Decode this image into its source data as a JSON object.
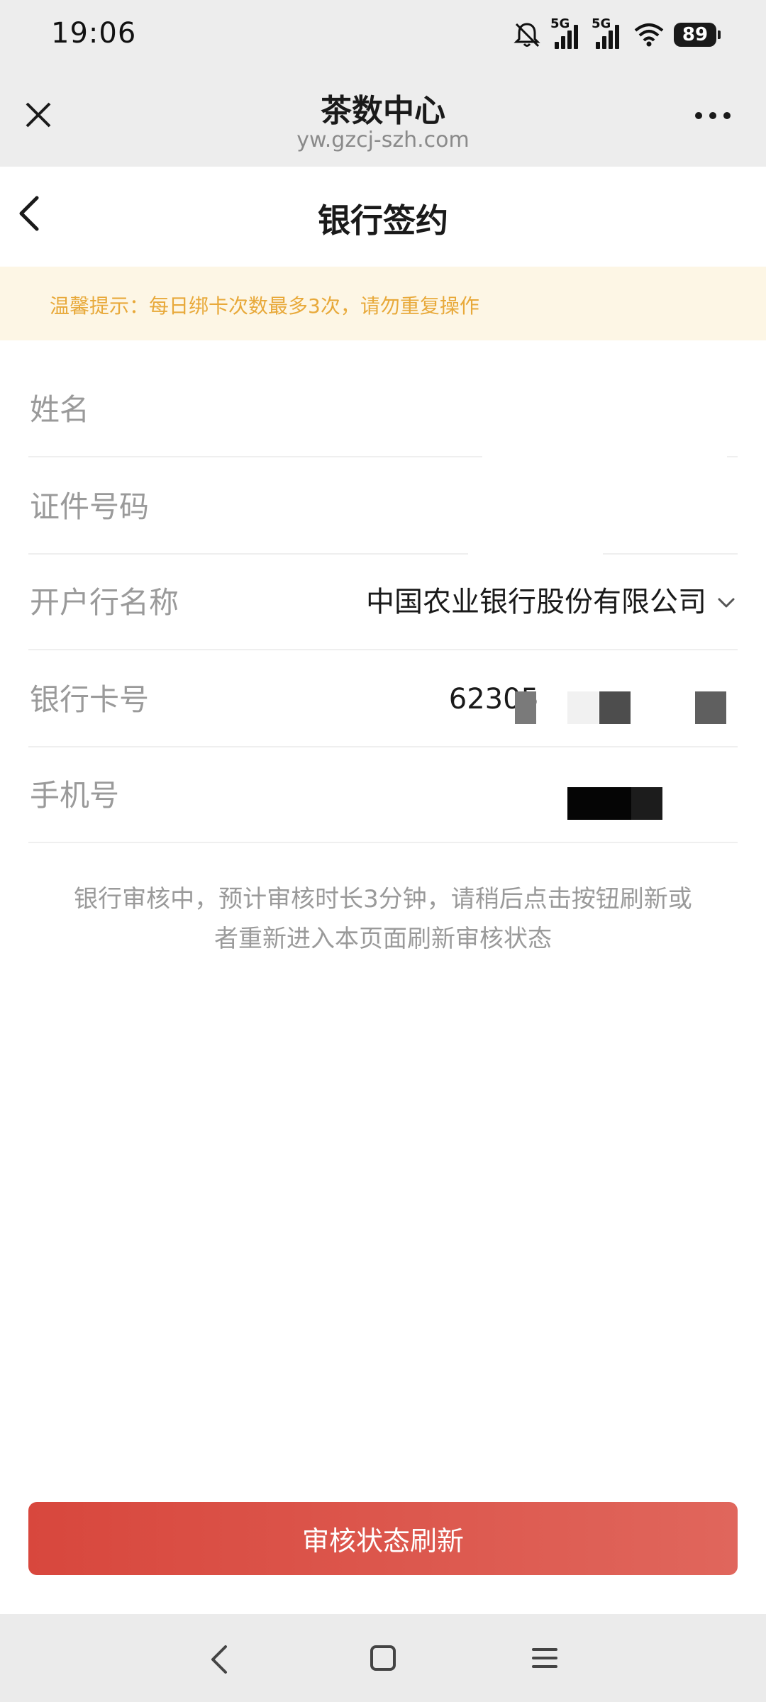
{
  "status_bar": {
    "time": "19:06",
    "network_1": "5G",
    "network_2": "5G",
    "battery": "89"
  },
  "browser": {
    "title": "茶数中心",
    "url": "yw.gzcj-szh.com"
  },
  "page": {
    "title": "银行签约"
  },
  "notice": {
    "text": "温馨提示：每日绑卡次数最多3次，请勿重复操作",
    "color": "#e8a93a",
    "background": "#fdf6e5"
  },
  "form": {
    "name": {
      "label": "姓名",
      "value": ""
    },
    "id_number": {
      "label": "证件号码",
      "value": ""
    },
    "bank": {
      "label": "开户行名称",
      "value": "中国农业银行股份有限公司"
    },
    "card_number": {
      "label": "银行卡号",
      "value": "62305"
    },
    "phone": {
      "label": "手机号",
      "value": ""
    }
  },
  "info": {
    "text": "银行审核中，预计审核时长3分钟，请稍后点击按钮刷新或者重新进入本页面刷新审核状态"
  },
  "refresh_button": {
    "label": "审核状态刷新",
    "color": "#d8473d"
  },
  "icons": {
    "close": "close-icon",
    "more": "more-icon",
    "back": "chevron-left-icon",
    "dropdown": "chevron-down-icon",
    "mute": "bell-off-icon",
    "wifi": "wifi-icon"
  }
}
